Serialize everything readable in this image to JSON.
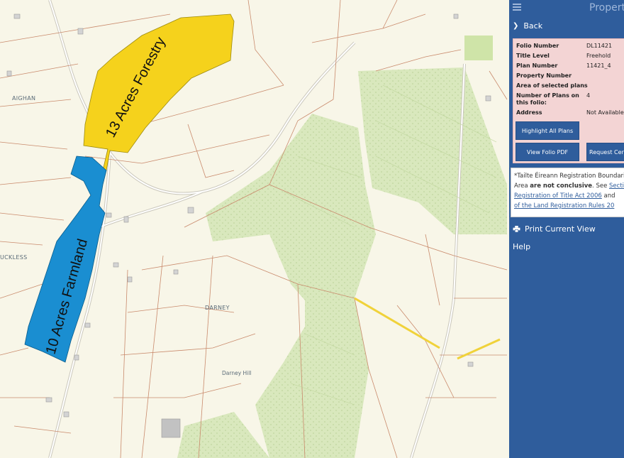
{
  "map": {
    "labels": {
      "aighan": "AIGHAN",
      "luckless": "UCKLESS",
      "darney": "DARNEY",
      "darney_hill": "Darney Hill"
    },
    "plots": {
      "forestry": {
        "label": "13 Acres Forestry",
        "color": "#f3d21c"
      },
      "farmland": {
        "label": "10 Acres Farmland",
        "color": "#1f8fd0"
      }
    },
    "colors": {
      "background": "#f8f6e8",
      "boundary": "#c97b5e",
      "woodland": "#d7e6b9",
      "road": "#c8c8c0",
      "highlight_line": "#f0d23a"
    }
  },
  "panel": {
    "title": "Propert",
    "back_label": "Back",
    "folio": {
      "rows": [
        {
          "key": "Folio Number",
          "value": "DL11421"
        },
        {
          "key": "Title Level",
          "value": "Freehold"
        },
        {
          "key": "Plan Number",
          "value": "11421_4"
        },
        {
          "key": "Property Number",
          "value": ""
        },
        {
          "key": "Area of selected plans",
          "value": ""
        },
        {
          "key": "Number of Plans on this folio:",
          "value": "4"
        },
        {
          "key": "Address",
          "value": "Not Available"
        }
      ],
      "highlight_button": "Highlight All Plans",
      "view_pdf_button": "View Folio PDF",
      "request_button": "Request Cert"
    },
    "notice": {
      "line1": "*Tailte Éireann Registration Boundari",
      "line2_pre": "Area ",
      "line2_bold": "are not conclusive",
      "line2_mid": ". See ",
      "line2_link": "Sectio",
      "line3_link": "Registration of Title Act 2006",
      "line3_post": " and",
      "line4_link": "of the Land Registration Rules 20"
    },
    "print_label": "Print Current View",
    "help_label": "Help",
    "colors": {
      "panel_bg": "#2f5d9c",
      "folio_bg": "#f3d4d4"
    }
  }
}
